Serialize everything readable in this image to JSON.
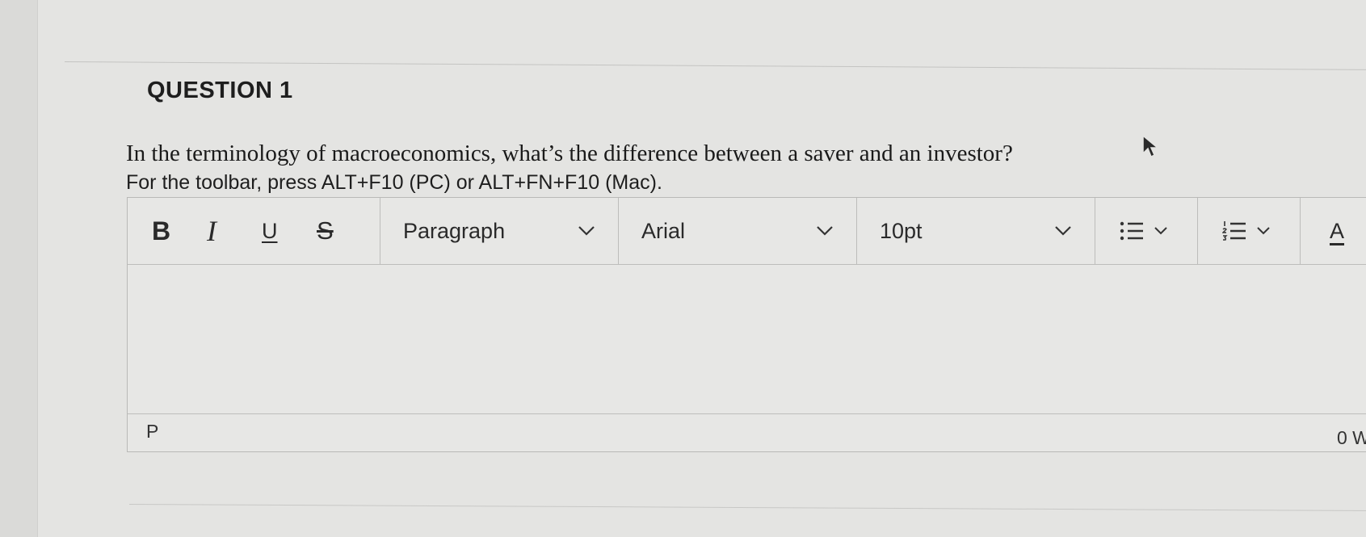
{
  "question": {
    "title": "QUESTION 1",
    "text": "In the terminology of macroeconomics, what’s the difference between a saver and an investor?",
    "toolbar_hint": "For the toolbar, press ALT+F10 (PC) or ALT+FN+F10 (Mac)."
  },
  "toolbar": {
    "bold_label": "B",
    "italic_label": "I",
    "underline_label": "U",
    "strikethrough_label": "S",
    "block_format": "Paragraph",
    "font_family": "Arial",
    "font_size": "10pt",
    "font_color_label": "A",
    "icons": {
      "bulleted_list": "bulleted-list-icon",
      "numbered_list": "numbered-list-icon",
      "dropdown": "chevron-down-icon"
    }
  },
  "editor": {
    "content": ""
  },
  "status_bar": {
    "path": "P",
    "word_count": "0 W"
  }
}
